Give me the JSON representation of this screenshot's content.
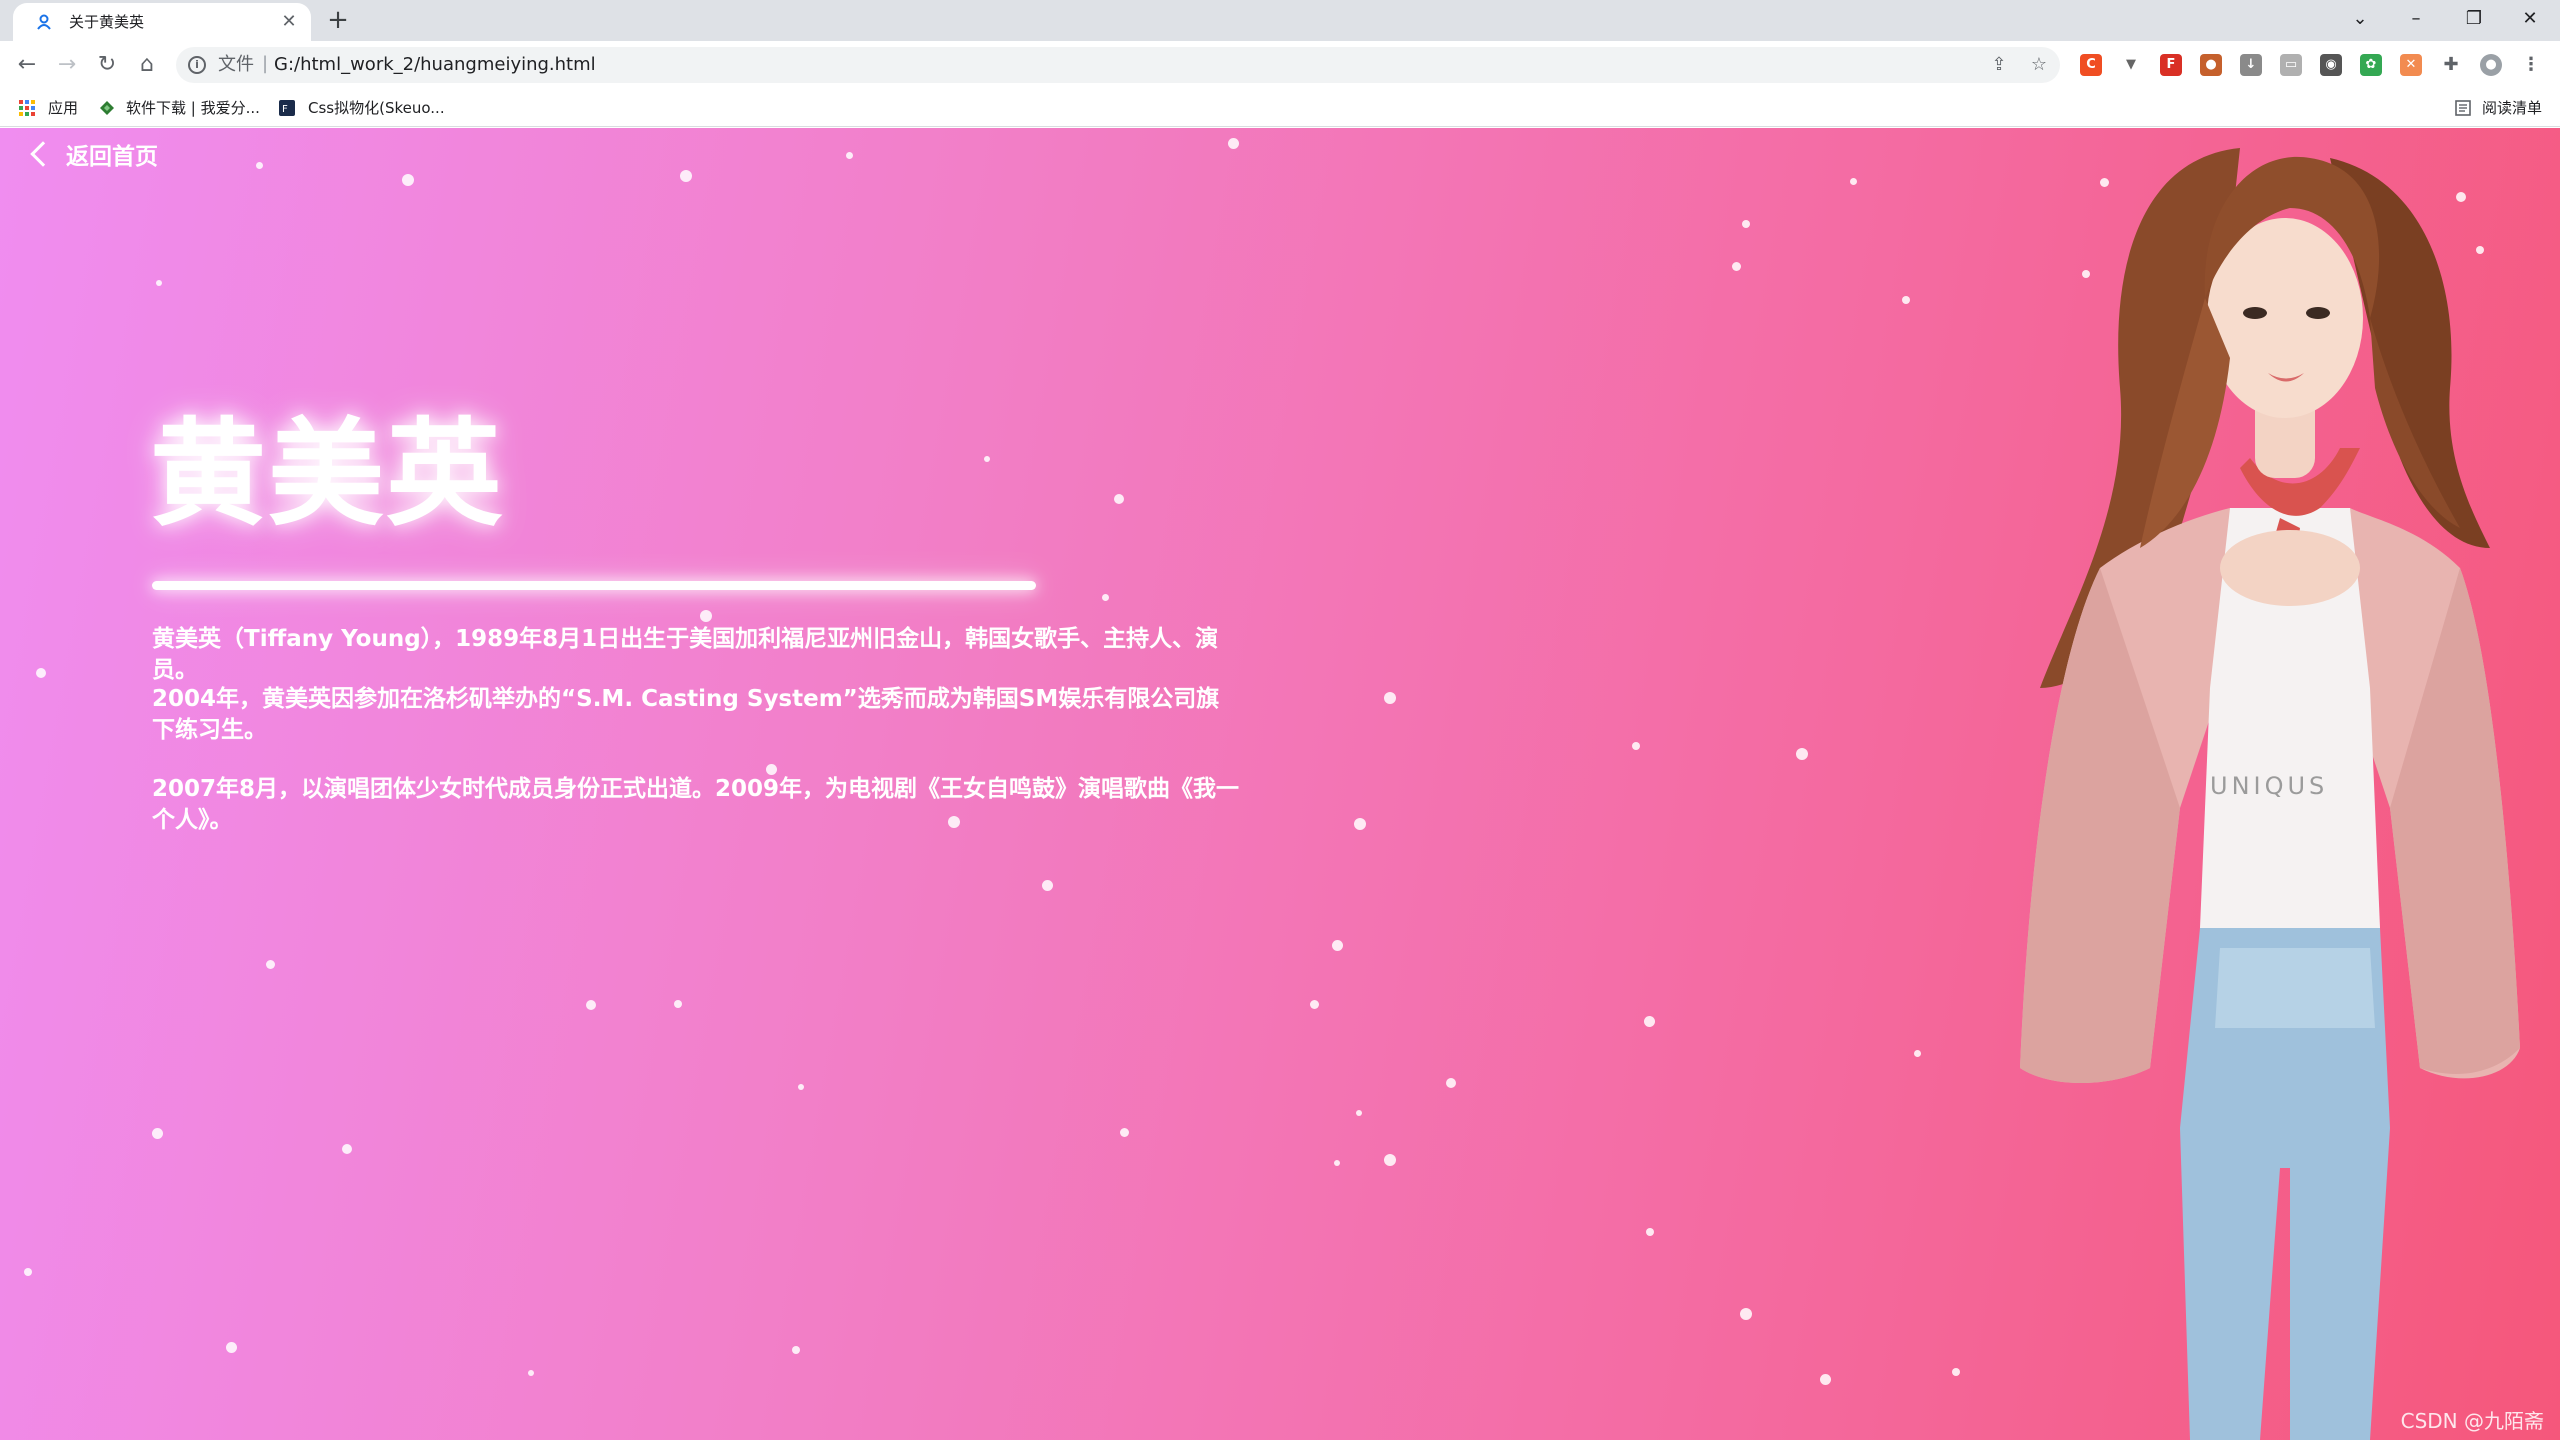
{
  "browser": {
    "tab_title": "关于黄美英",
    "address_prefix": "文件",
    "address_sep": "|",
    "url": "G:/html_work_2/huangmeiying.html",
    "bookmarks": [
      {
        "label": "应用"
      },
      {
        "label": "软件下载 | 我爱分..."
      },
      {
        "label": "Css拟物化(Skeuo..."
      }
    ],
    "reading_list": "阅读清单"
  },
  "page": {
    "back_label": "返回首页",
    "name": "黄美英",
    "bio": [
      "黄美英（Tiffany Young），1989年8月1日出生于美国加利福尼亚州旧金山，韩国女歌手、主持人、演员。",
      "2004年，黄美英因参加在洛杉矶举办的“S.M. Casting System”选秀而成为韩国SM娱乐有限公司旗下练习生。",
      "2007年8月，以演唱团体少女时代成员身份正式出道。2009年，为电视剧《王女自鸣鼓》演唱歌曲《我一个人》。"
    ],
    "shirt_text": "UNIQUS",
    "watermark": "CSDN @九陌斋"
  },
  "colors": {
    "gradient_start": "#f08df0",
    "gradient_end": "#f5577b",
    "text": "#ffffff"
  }
}
